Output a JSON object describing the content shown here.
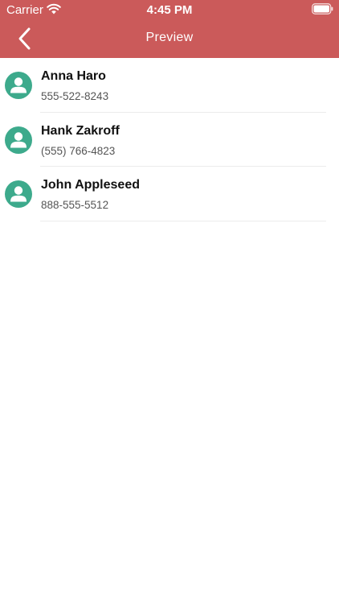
{
  "status_bar": {
    "carrier": "Carrier",
    "time": "4:45 PM",
    "wifi_icon": "wifi-icon",
    "battery_icon": "battery-icon"
  },
  "nav": {
    "title": "Preview",
    "back_icon": "chevron-left-icon"
  },
  "colors": {
    "header": "#CB5A5A",
    "avatar": "#3DAA8C"
  },
  "contacts": [
    {
      "name": "Anna Haro",
      "phone": "555-522-8243"
    },
    {
      "name": "Hank Zakroff",
      "phone": "(555) 766-4823"
    },
    {
      "name": "John Appleseed",
      "phone": "888-555-5512"
    }
  ]
}
